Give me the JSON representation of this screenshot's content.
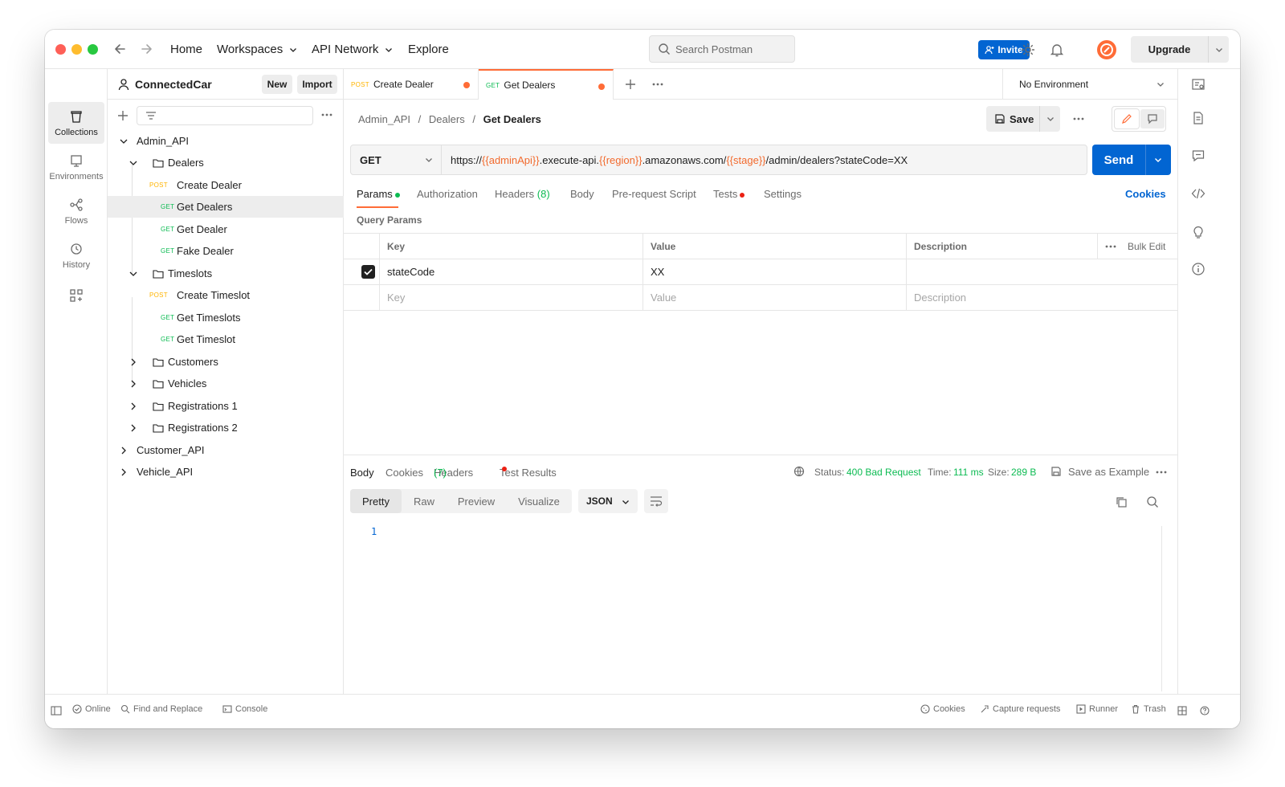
{
  "topnav": {
    "home": "Home",
    "workspaces": "Workspaces",
    "api_network": "API Network",
    "explore": "Explore",
    "search_placeholder": "Search Postman",
    "invite": "Invite",
    "upgrade": "Upgrade"
  },
  "workspace": {
    "name": "ConnectedCar",
    "new_btn": "New",
    "import_btn": "Import"
  },
  "rail": [
    {
      "label": "Collections",
      "icon": "collections-icon"
    },
    {
      "label": "Environments",
      "icon": "environments-icon"
    },
    {
      "label": "Flows",
      "icon": "flows-icon"
    },
    {
      "label": "History",
      "icon": "history-icon"
    }
  ],
  "tree": [
    {
      "label": "Admin_API",
      "type": "collection",
      "expanded": true
    },
    {
      "label": "Dealers",
      "type": "folder",
      "expanded": true
    },
    {
      "label": "Create Dealer",
      "type": "request",
      "method": "POST"
    },
    {
      "label": "Get Dealers",
      "type": "request",
      "method": "GET",
      "selected": true
    },
    {
      "label": "Get Dealer",
      "type": "request",
      "method": "GET"
    },
    {
      "label": "Fake Dealer",
      "type": "request",
      "method": "GET"
    },
    {
      "label": "Timeslots",
      "type": "folder",
      "expanded": true
    },
    {
      "label": "Create Timeslot",
      "type": "request",
      "method": "POST"
    },
    {
      "label": "Get Timeslots",
      "type": "request",
      "method": "GET"
    },
    {
      "label": "Get Timeslot",
      "type": "request",
      "method": "GET"
    },
    {
      "label": "Customers",
      "type": "folder"
    },
    {
      "label": "Vehicles",
      "type": "folder"
    },
    {
      "label": "Registrations 1",
      "type": "folder"
    },
    {
      "label": "Registrations 2",
      "type": "folder"
    },
    {
      "label": "Customer_API",
      "type": "collection"
    },
    {
      "label": "Vehicle_API",
      "type": "collection"
    }
  ],
  "tabs": [
    {
      "method": "POST",
      "label": "Create Dealer"
    },
    {
      "method": "GET",
      "label": "Get Dealers"
    }
  ],
  "environment": "No Environment",
  "breadcrumb": {
    "part1": "Admin_API",
    "part2": "Dealers",
    "current": "Get Dealers",
    "sep": "/"
  },
  "save_label": "Save",
  "request": {
    "method": "GET",
    "url_prefix": "https://",
    "var1": "{{adminApi}}",
    "url_mid1": ".execute-api.",
    "var2": "{{region}}",
    "url_mid2": ".amazonaws.com/",
    "var3": "{{stage}}",
    "url_suffix": "/admin/dealers?stateCode=XX",
    "send": "Send"
  },
  "req_tabs": {
    "params": "Params",
    "authorization": "Authorization",
    "headers": "Headers",
    "headers_count": "(8)",
    "body": "Body",
    "prerequest": "Pre-request Script",
    "tests": "Tests",
    "settings": "Settings",
    "cookies": "Cookies"
  },
  "query_params": {
    "title": "Query Params",
    "headers": {
      "key": "Key",
      "value": "Value",
      "description": "Description",
      "bulk_edit": "Bulk Edit"
    },
    "rows": [
      {
        "checked": true,
        "key": "stateCode",
        "value": "XX",
        "description": ""
      }
    ],
    "placeholders": {
      "key": "Key",
      "value": "Value",
      "description": "Description"
    }
  },
  "response": {
    "tabs": {
      "body": "Body",
      "cookies": "Cookies",
      "headers": "Headers",
      "headers_count": "(7)",
      "test_results": "Test Results"
    },
    "status_label": "Status:",
    "status_value": "400 Bad Request",
    "time_label": "Time:",
    "time_value": "111 ms",
    "size_label": "Size:",
    "size_value": "289 B",
    "save_example": "Save as Example",
    "view_tabs": [
      "Pretty",
      "Raw",
      "Preview",
      "Visualize"
    ],
    "format": "JSON",
    "line_number": "1"
  },
  "statusbar": {
    "online": "Online",
    "find_replace": "Find and Replace",
    "console": "Console",
    "cookies": "Cookies",
    "capture": "Capture requests",
    "runner": "Runner",
    "trash": "Trash"
  },
  "colors": {
    "accent": "#ff6c37",
    "primary": "#0265d2",
    "get": "#0cbb52",
    "post": "#ffb400"
  }
}
